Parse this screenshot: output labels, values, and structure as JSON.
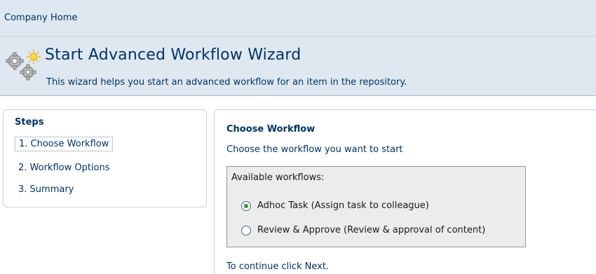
{
  "breadcrumb": "Company Home",
  "header": {
    "title": "Start Advanced Workflow Wizard",
    "description": "This wizard helps you start an advanced workflow for an item in the repository."
  },
  "steps": {
    "title": "Steps",
    "items": [
      {
        "label": "1. Choose Workflow"
      },
      {
        "label": "2. Workflow Options"
      },
      {
        "label": "3. Summary"
      }
    ]
  },
  "content": {
    "title": "Choose Workflow",
    "description": "Choose the workflow you want to start",
    "box_label": "Available workflows:",
    "workflows": [
      {
        "label": "Adhoc Task (Assign task to colleague)",
        "selected": true
      },
      {
        "label": "Review & Approve (Review & approval of content)",
        "selected": false
      }
    ],
    "continue": "To continue click Next."
  }
}
